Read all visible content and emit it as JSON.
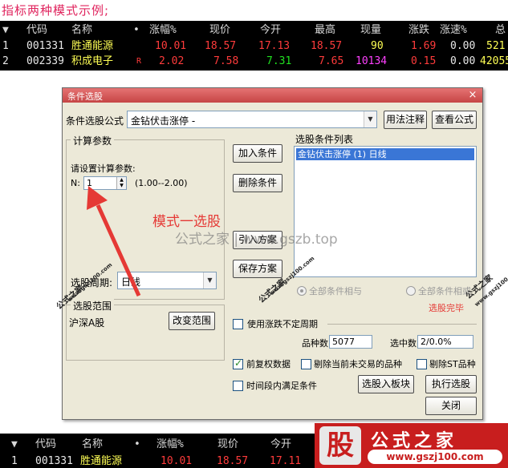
{
  "caption": "指标两种模式示例;",
  "table_top": {
    "header": {
      "arrow": "▼",
      "code": "代码",
      "name": "名称",
      "dot": "•",
      "pct": "涨幅%",
      "price": "现价",
      "open": "今开",
      "high": "最高",
      "vol": "现量",
      "chg": "涨跌",
      "speed": "涨速%",
      "total": "总"
    },
    "rows": [
      {
        "idx": "1",
        "code": "001331",
        "name": "胜通能源",
        "flag": "",
        "pct": "10.01",
        "price": "18.57",
        "open": "17.13",
        "high": "18.57",
        "vol": "90",
        "chg": "1.69",
        "speed": "0.00",
        "total": "521"
      },
      {
        "idx": "2",
        "code": "002339",
        "name": "积成电子",
        "flag": "R",
        "pct": "2.02",
        "price": "7.58",
        "open": "7.31",
        "high": "7.65",
        "vol": "10134",
        "chg": "0.15",
        "speed": "0.00",
        "total": "42055"
      }
    ]
  },
  "dialog": {
    "title": "条件选股",
    "close": "×",
    "formula_label": "条件选股公式",
    "formula_value": "金钻伏击涨停 -",
    "usage_btn": "用法注释",
    "view_btn": "查看公式",
    "calc_group": "计算参数",
    "param_prompt": "请设置计算参数:",
    "param_name": "N:",
    "param_value": "1",
    "param_range": "(1.00--2.00)",
    "add_btn": "加入条件",
    "del_btn": "删除条件",
    "import_btn": "引入方案",
    "save_btn": "保存方案",
    "list_title": "选股条件列表",
    "list_items": [
      "金钻伏击涨停 (1) 日线"
    ],
    "period_label": "选股周期:",
    "period_value": "日线",
    "all_and": "全部条件相与",
    "all_or": "全部条件相或",
    "done": "选股完毕",
    "range_group": "选股范围",
    "range_value": "沪深A股",
    "change_range_btn": "改变范围",
    "use_period": "使用涨跌不定周期",
    "count_label": "品种数",
    "count_value": "5077",
    "hit_label": "选中数",
    "hit_value": "2/0.0%",
    "pre_adj": "前复权数据",
    "excl_untraded": "剔除当前未交易的品种",
    "excl_st": "剔除ST品种",
    "time_range": "时间段内满足条件",
    "to_board_btn": "选股入板块",
    "run_btn": "执行选股",
    "close_btn": "关闭"
  },
  "annotation": "模式一选股",
  "watermark": "公式之家 | www.gszb.top",
  "stamps": [
    "公式之家",
    "www.gszj100.com"
  ],
  "table_bottom": {
    "header": {
      "arrow": "▼",
      "code": "代码",
      "name": "名称",
      "dot": "•",
      "pct": "涨幅%",
      "price": "现价",
      "open": "今开"
    },
    "rows": [
      {
        "idx": "1",
        "code": "001331",
        "name": "胜通能源",
        "pct": "10.01",
        "price": "18.57",
        "open": "17.11"
      }
    ]
  },
  "brand": {
    "logo": "股",
    "name": "公式之家",
    "url": "www.gszj100.com"
  }
}
